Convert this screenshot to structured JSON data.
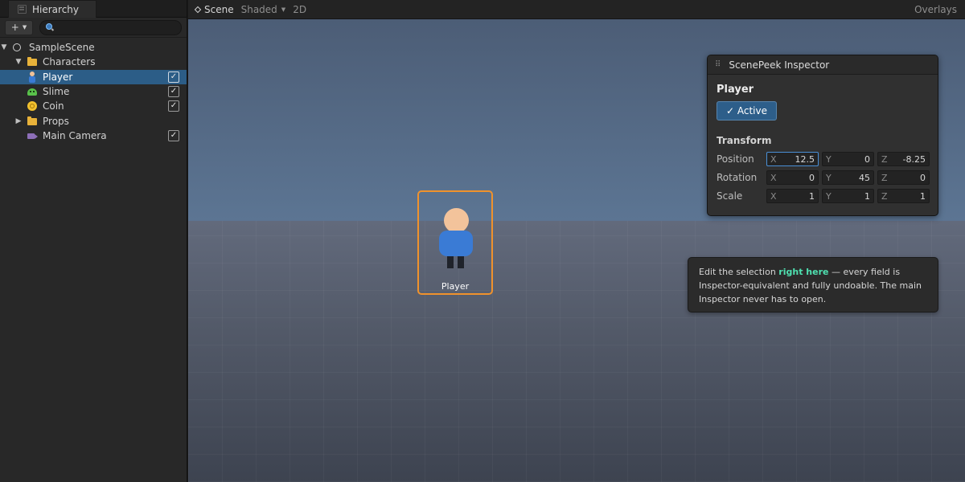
{
  "hierarchy": {
    "tab_label": "Hierarchy",
    "add_button": "+",
    "search_placeholder": "",
    "items": [
      {
        "label": "SampleScene",
        "icon": "scene-icon",
        "expanded": true
      },
      {
        "label": "Characters",
        "icon": "folder-icon",
        "expanded": true
      },
      {
        "label": "Player",
        "icon": "player-icon",
        "selected": true,
        "checked": true
      },
      {
        "label": "Slime",
        "icon": "slime-icon",
        "checked": true
      },
      {
        "label": "Coin",
        "icon": "coin-icon",
        "checked": true
      },
      {
        "label": "Props",
        "icon": "folder-icon",
        "expanded": false
      },
      {
        "label": "Main Camera",
        "icon": "camera-icon",
        "checked": true
      }
    ],
    "check_mark": "✓"
  },
  "scene": {
    "tab_label": "Scene",
    "shading_mode": "Shaded",
    "mode_2d": "2D",
    "overlays_label": "Overlays",
    "selected_object_label": "Player"
  },
  "inspector": {
    "title": "ScenePeek Inspector",
    "object_name": "Player",
    "active_label": "✓ Active",
    "section": "Transform",
    "axis_labels": [
      "X",
      "Y",
      "Z"
    ],
    "rows": [
      {
        "label": "Position",
        "x": "12.5",
        "y": "0",
        "z": "-8.25"
      },
      {
        "label": "Rotation",
        "x": "0",
        "y": "45",
        "z": "0"
      },
      {
        "label": "Scale",
        "x": "1",
        "y": "1",
        "z": "1"
      }
    ]
  },
  "tooltip": {
    "before": "Edit the selection ",
    "highlight": "right here",
    "after": " — every field is Inspector-equivalent and fully undoable. The main Inspector never has to open."
  },
  "colors": {
    "selection_blue": "#2c5d87",
    "selection_outline": "#f0922c",
    "highlight_green": "#4fe0b0"
  }
}
